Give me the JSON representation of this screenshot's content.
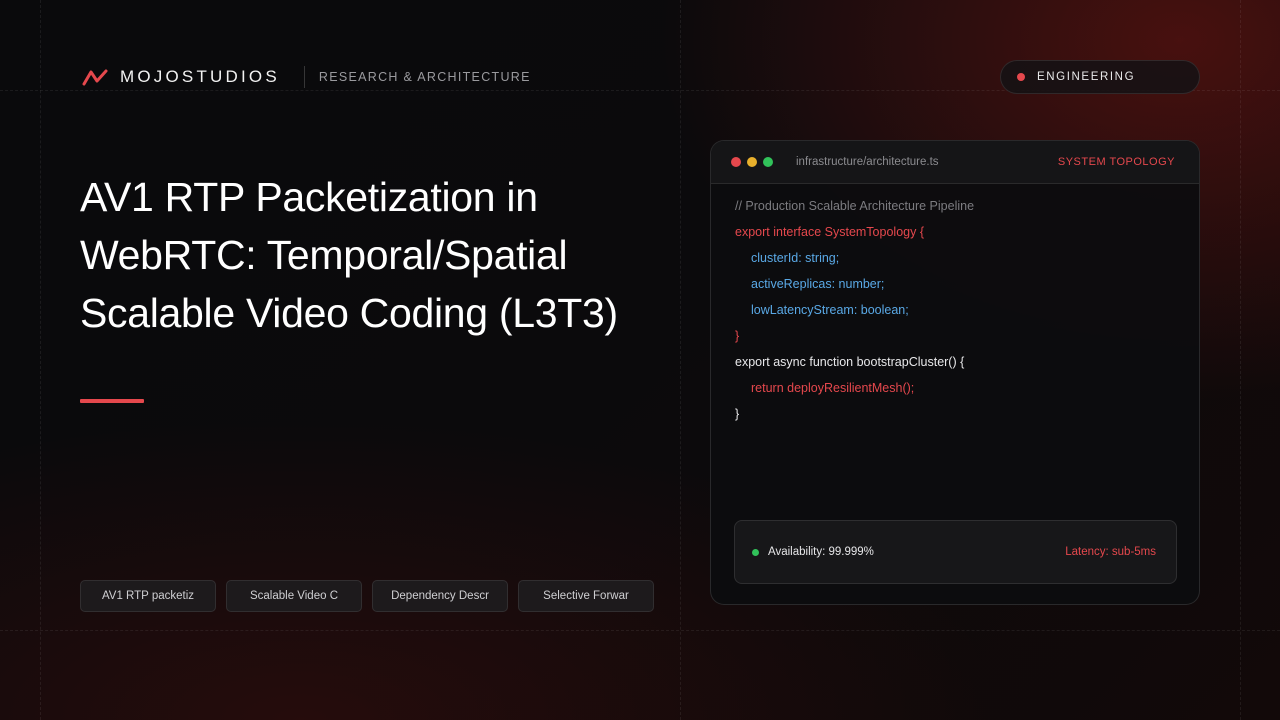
{
  "header": {
    "brand": "MOJOSTUDIOS",
    "subtitle": "RESEARCH & ARCHITECTURE",
    "badge": "ENGINEERING"
  },
  "title": {
    "line1": "AV1 RTP Packetization in",
    "line2": "WebRTC: Temporal/Spatial",
    "line3": "Scalable Video Coding (L3T3)"
  },
  "tags": [
    "AV1 RTP packetiz",
    "Scalable Video C",
    "Dependency Descr",
    "Selective Forwar"
  ],
  "code_window": {
    "filename": "infrastructure/architecture.ts",
    "label": "SYSTEM TOPOLOGY",
    "lines": [
      "// Production Scalable Architecture Pipeline",
      "export interface SystemTopology {",
      "clusterId: string;",
      "activeReplicas: number;",
      "lowLatencyStream: boolean;",
      "}",
      "export async function bootstrapCluster() {",
      "return deployResilientMesh();",
      "}"
    ],
    "status": {
      "availability": "Availability: 99.999%",
      "latency": "Latency: sub-5ms"
    }
  },
  "colors": {
    "accent": "#e5484d",
    "code_blue": "#5aa9e6",
    "status_green": "#31c25a",
    "background": "#0a0a0c"
  },
  "icons": {
    "logo": "mojostudios-logo-icon",
    "window_controls": [
      "close-dot-icon",
      "minimize-dot-icon",
      "maximize-dot-icon"
    ]
  }
}
